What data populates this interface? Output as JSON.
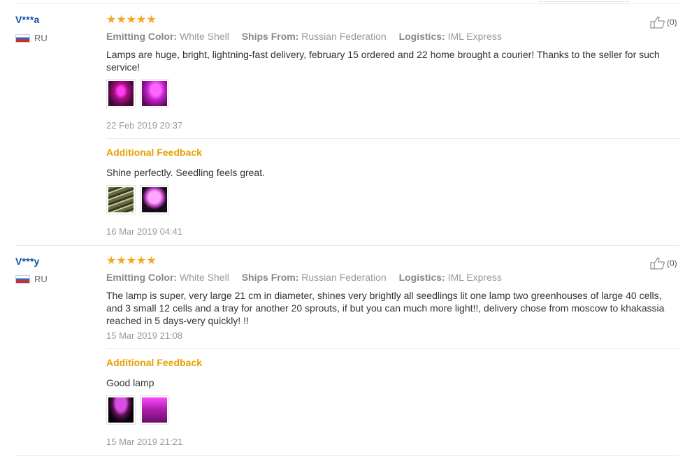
{
  "reviews": [
    {
      "user": "V***a",
      "country": "RU",
      "rating": 5,
      "attributes": [
        {
          "label": "Emitting Color:",
          "value": "White Shell"
        },
        {
          "label": "Ships From:",
          "value": "Russian Federation"
        },
        {
          "label": "Logistics:",
          "value": "IML Express"
        }
      ],
      "text": "Lamps are huge, bright, lightning-fast delivery, february 15 ordered and 22 home brought a courier! Thanks to the seller for such service!",
      "date": "22 Feb 2019 20:37",
      "helpful": "(0)",
      "additional": {
        "heading": "Additional Feedback",
        "text": "Shine perfectly. Seedling feels great.",
        "date": "16 Mar 2019 04:41"
      }
    },
    {
      "user": "V***y",
      "country": "RU",
      "rating": 5,
      "attributes": [
        {
          "label": "Emitting Color:",
          "value": "White Shell"
        },
        {
          "label": "Ships From:",
          "value": "Russian Federation"
        },
        {
          "label": "Logistics:",
          "value": "IML Express"
        }
      ],
      "text": "The lamp is super, very large 21 cm in diameter, shines very brightly all seedlings lit one lamp two greenhouses of large 40 cells, and 3 small 12 cells and a tray for another 20 sprouts, if but you can much more light!!, delivery chose from moscow to khakassia reached in 5 days-very quickly! !!",
      "date": "15 Mar 2019 21:08",
      "helpful": "(0)",
      "additional": {
        "heading": "Additional Feedback",
        "text": "Good lamp",
        "date": "15 Mar 2019 21:21"
      }
    }
  ],
  "colors": {
    "username": "#0f4fa8",
    "star": "#f5a623",
    "additional_heading": "#e8a000"
  },
  "icons": [
    "russia-flag-icon",
    "star-icon",
    "thumbs-up-icon"
  ]
}
